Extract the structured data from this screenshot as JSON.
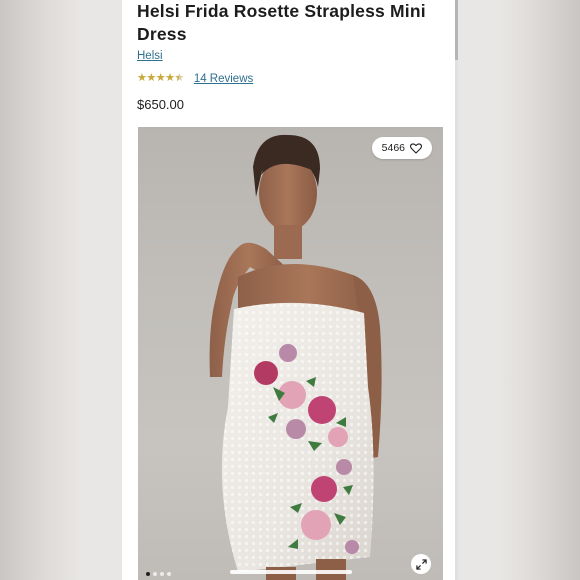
{
  "product": {
    "title": "Helsi Frida Rosette Strapless Mini Dress",
    "brand": "Helsi",
    "rating": {
      "value": 4.5,
      "max": 5,
      "stars_text": "★★★★★"
    },
    "reviews_label": "14 Reviews",
    "price": "$650.00"
  },
  "gallery": {
    "likes_count": "5466",
    "slide_count": 4,
    "active_slide": 1,
    "icons": {
      "heart": "heart-icon",
      "expand": "expand-icon"
    }
  },
  "colors": {
    "link": "#2f6f8f",
    "star": "#c9a93b",
    "text": "#1d1d1d"
  }
}
